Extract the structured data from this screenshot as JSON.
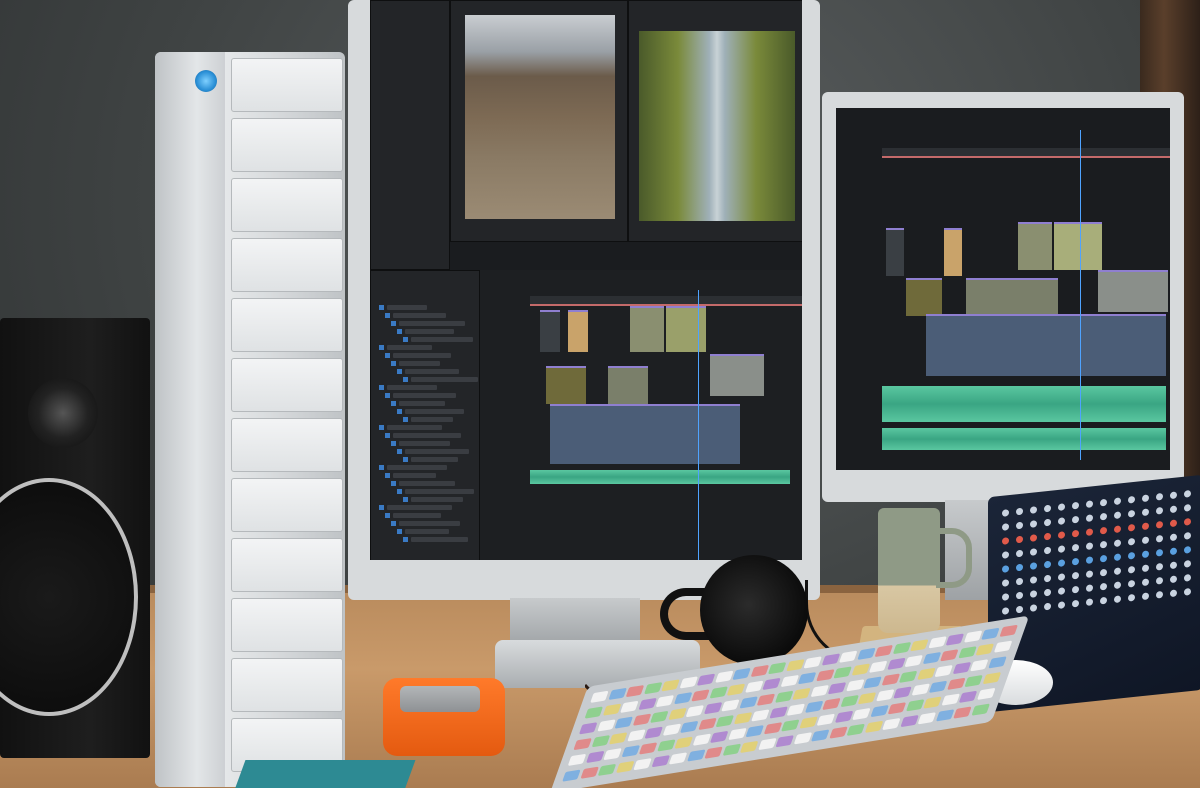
{
  "scene": {
    "description_colors": {
      "wall": "#4a4e4f",
      "desk": "#c09263",
      "storage_tower": "#e6e8ea",
      "storage_led": "#2a8fd6",
      "rugged_drive": "#f06a1e",
      "mixer": "#16203a",
      "mug": "#8f9a86",
      "timeline_video_track": "#4b5d77",
      "timeline_audio_track": "#4fbf97",
      "playhead": "#4fa3ff"
    },
    "icons": [
      "speaker-icon",
      "storage-tower-icon",
      "monitor-icon",
      "mug-icon",
      "headphones-icon",
      "mixer-icon",
      "keyboard-icon",
      "mouse-icon",
      "glasses-icon",
      "portable-drive-icon"
    ]
  }
}
